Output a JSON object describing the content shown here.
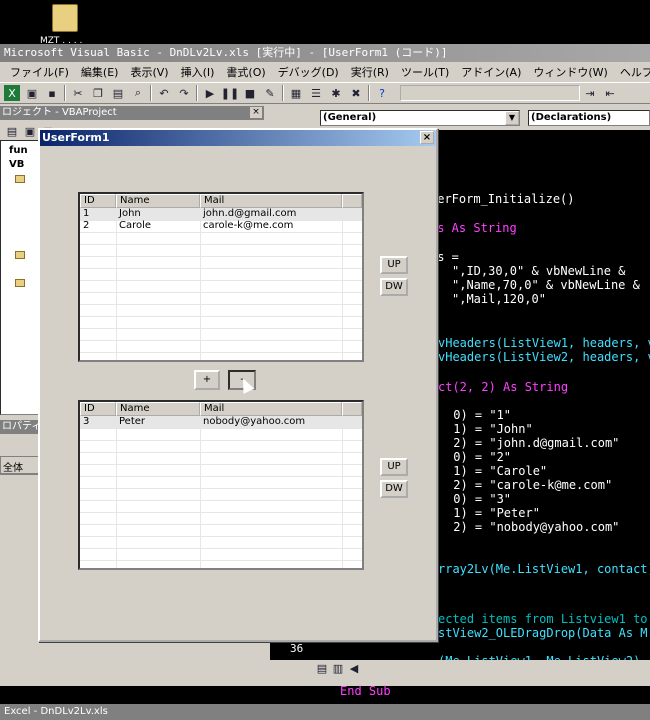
{
  "desktop": {
    "icon_label": "MZT . . . ."
  },
  "vbe": {
    "title": "Microsoft Visual Basic - DnDLv2Lv.xls [実行中] - [UserForm1 (コード)]",
    "menu": [
      "ファイル(F)",
      "編集(E)",
      "表示(V)",
      "挿入(I)",
      "書式(O)",
      "デバッグ(D)",
      "実行(R)",
      "ツール(T)",
      "アドイン(A)",
      "ウィンドウ(W)",
      "ヘルプ(H)"
    ],
    "project_title": "ロジェクト - VBAProject",
    "project_items": [
      "fun",
      "VB"
    ],
    "properties_title": "ロパティ",
    "properties_tab": "全体",
    "combo_left": "(General)",
    "combo_right": "(Declarations)",
    "line_number": "36"
  },
  "code_lines": [
    {
      "text": "serForm_Initialize()",
      "cls": "tx"
    },
    {
      "text": "rs As String",
      "cls": "kw"
    },
    {
      "text": "rs =",
      "cls": "tx"
    },
    {
      "text": "\",ID,30,0\" & vbNewLine &",
      "cls": "tx"
    },
    {
      "text": "\",Name,70,0\" & vbNewLine &",
      "cls": "tx"
    },
    {
      "text": "\",Mail,120,0\"",
      "cls": "tx"
    },
    {
      "text": "vHeaders(ListView1, headers, v",
      "cls": "cy"
    },
    {
      "text": "vHeaders(ListView2, headers, v",
      "cls": "cy"
    },
    {
      "text": "ct(2, 2) As String",
      "cls": "kw"
    },
    {
      "text": " 0) = \"1\"",
      "cls": "tx"
    },
    {
      "text": " 1) = \"John\"",
      "cls": "tx"
    },
    {
      "text": " 2) = \"john.d@gmail.com\"",
      "cls": "tx"
    },
    {
      "text": " 0) = \"2\"",
      "cls": "tx"
    },
    {
      "text": " 1) = \"Carole\"",
      "cls": "tx"
    },
    {
      "text": " 2) = \"carole-k@me.com\"",
      "cls": "tx"
    },
    {
      "text": " 0) = \"3\"",
      "cls": "tx"
    },
    {
      "text": " 1) = \"Peter\"",
      "cls": "tx"
    },
    {
      "text": " 2) = \"nobody@yahoo.com\"",
      "cls": "tx"
    },
    {
      "text": "rray2Lv(Me.ListView1, contact)",
      "cls": "cy"
    },
    {
      "text": "ected items from Listview1 to",
      "cls": "cm"
    },
    {
      "text": "stView2_OLEDragDrop(Data As M",
      "cls": "cy"
    },
    {
      "text": "(Me.ListView1, Me.ListView2)",
      "cls": "cy"
    },
    {
      "text": "End Sub",
      "cls": "kw"
    }
  ],
  "userform": {
    "title": "UserForm1",
    "close": "×",
    "headers": [
      "ID",
      "Name",
      "Mail"
    ],
    "list1": [
      [
        "1",
        "John",
        "john.d@gmail.com"
      ],
      [
        "2",
        "Carole",
        "carole-k@me.com"
      ]
    ],
    "list2": [
      [
        "3",
        "Peter",
        "nobody@yahoo.com"
      ]
    ],
    "up_label": "UP",
    "dw_label": "DW",
    "add_label": "+",
    "minus_label": "-"
  },
  "taskbar": {
    "text": "Excel - DnDLv2Lv.xls"
  }
}
